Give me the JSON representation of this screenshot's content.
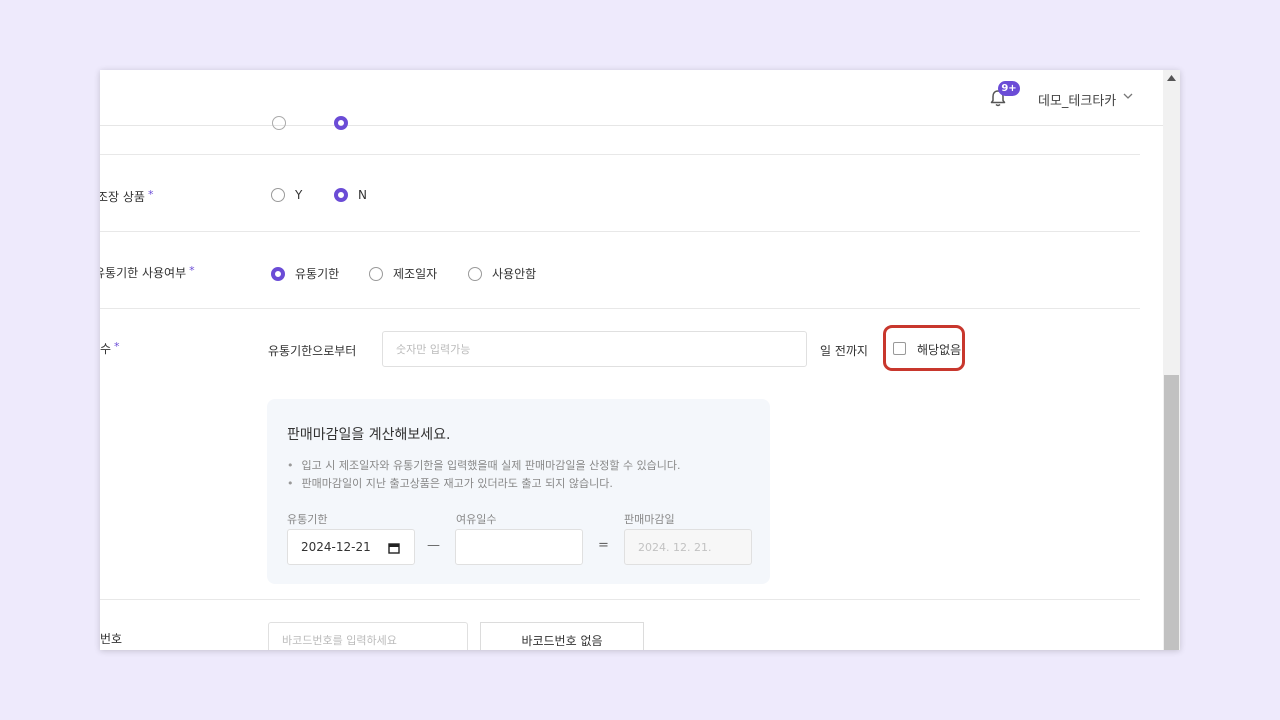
{
  "header": {
    "notification_badge": "9+",
    "username": "데모_테크타카",
    "icons": [
      "bell-icon",
      "chevron-down-icon"
    ]
  },
  "form": {
    "row_boxed": {
      "label": "조장 상품",
      "required": "*",
      "options": [
        {
          "label": "Y",
          "selected": false
        },
        {
          "label": "N",
          "selected": true
        }
      ]
    },
    "row_expiry_usage": {
      "label": "유통기한 사용여부",
      "required": "*",
      "options": [
        {
          "label": "유통기한",
          "selected": true
        },
        {
          "label": "제조일자",
          "selected": false
        },
        {
          "label": "사용안함",
          "selected": false
        }
      ]
    },
    "row_days": {
      "label": "수",
      "required": "*",
      "prefix": "유통기한으로부터",
      "input_placeholder": "숫자만 입력가능",
      "suffix": "일 전까지",
      "not_applicable_label": "해당없음",
      "not_applicable_checked": false
    },
    "calculator": {
      "title": "판매마감일을 계산해보세요.",
      "notes": [
        "입고 시 제조일자와 유통기한을 입력했을때 실제 판매마감일을 산정할 수 있습니다.",
        "판매마감일이 지난 출고상품은 재고가 있더라도 출고 되지 않습니다."
      ],
      "expiry_label": "유통기한",
      "expiry_value": "2024-12-21",
      "minus_sign": "—",
      "margin_label": "여유일수",
      "margin_value": "",
      "equals_sign": "=",
      "result_label": "판매마감일",
      "result_value": "2024. 12. 21."
    },
    "row_barcode": {
      "label": "번호",
      "input_placeholder": "바코드번호를 입력하세요",
      "no_barcode_button": "바코드번호 없음"
    }
  },
  "colors": {
    "accent": "#6b4cd6",
    "highlight": "#c8372d",
    "page_background": "#eeeafc"
  }
}
